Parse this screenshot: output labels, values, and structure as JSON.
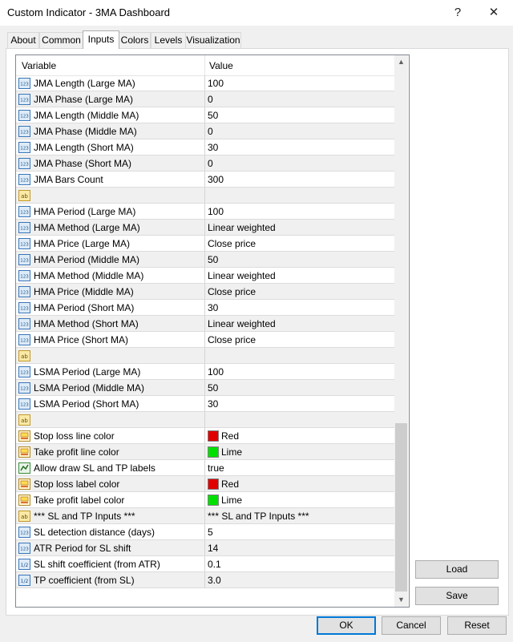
{
  "window": {
    "title": "Custom Indicator - 3MA Dashboard",
    "help": "?",
    "close": "✕"
  },
  "tabs": [
    "About",
    "Common",
    "Inputs",
    "Colors",
    "Levels",
    "Visualization"
  ],
  "grid": {
    "col_variable": "Variable",
    "col_value": "Value",
    "rows": [
      {
        "icon": "int",
        "name": "JMA Length (Large MA)",
        "value": "100"
      },
      {
        "icon": "int",
        "name": "JMA Phase (Large MA)",
        "value": "0"
      },
      {
        "icon": "int",
        "name": "JMA Length (Middle MA)",
        "value": "50"
      },
      {
        "icon": "int",
        "name": "JMA Phase (Middle MA)",
        "value": "0"
      },
      {
        "icon": "int",
        "name": "JMA Length (Short MA)",
        "value": "30"
      },
      {
        "icon": "int",
        "name": "JMA Phase (Short MA)",
        "value": "0"
      },
      {
        "icon": "int",
        "name": "JMA Bars Count",
        "value": "300"
      },
      {
        "icon": "str",
        "name": "",
        "value": ""
      },
      {
        "icon": "int",
        "name": "HMA Period (Large MA)",
        "value": "100"
      },
      {
        "icon": "int",
        "name": "HMA Method (Large MA)",
        "value": "Linear weighted"
      },
      {
        "icon": "int",
        "name": "HMA Price (Large MA)",
        "value": "Close price"
      },
      {
        "icon": "int",
        "name": "HMA Period (Middle MA)",
        "value": "50"
      },
      {
        "icon": "int",
        "name": "HMA Method (Middle MA)",
        "value": "Linear weighted"
      },
      {
        "icon": "int",
        "name": "HMA Price (Middle MA)",
        "value": "Close price"
      },
      {
        "icon": "int",
        "name": "HMA Period (Short MA)",
        "value": "30"
      },
      {
        "icon": "int",
        "name": "HMA Method (Short MA)",
        "value": "Linear weighted"
      },
      {
        "icon": "int",
        "name": "HMA Price (Short MA)",
        "value": "Close price"
      },
      {
        "icon": "str",
        "name": "",
        "value": ""
      },
      {
        "icon": "int",
        "name": "LSMA Period (Large MA)",
        "value": "100"
      },
      {
        "icon": "int",
        "name": "LSMA Period (Middle MA)",
        "value": "50"
      },
      {
        "icon": "int",
        "name": "LSMA Period (Short MA)",
        "value": "30"
      },
      {
        "icon": "str",
        "name": "",
        "value": ""
      },
      {
        "icon": "color",
        "name": "Stop loss line color",
        "value": "Red",
        "swatch": "#e00000"
      },
      {
        "icon": "color",
        "name": "Take profit line color",
        "value": "Lime",
        "swatch": "#00e000"
      },
      {
        "icon": "bool",
        "name": "Allow draw SL and TP labels",
        "value": "true"
      },
      {
        "icon": "color",
        "name": "Stop loss label color",
        "value": "Red",
        "swatch": "#e00000"
      },
      {
        "icon": "color",
        "name": "Take profit label color",
        "value": "Lime",
        "swatch": "#00e000"
      },
      {
        "icon": "str",
        "name": "*** SL and TP Inputs ***",
        "value": "*** SL and TP Inputs ***"
      },
      {
        "icon": "int",
        "name": "SL detection distance (days)",
        "value": "5"
      },
      {
        "icon": "int",
        "name": "ATR Period for SL shift",
        "value": "14"
      },
      {
        "icon": "dbl",
        "name": "SL shift coefficient (from ATR)",
        "value": "0.1"
      },
      {
        "icon": "dbl",
        "name": "TP coefficient (from SL)",
        "value": "3.0"
      }
    ]
  },
  "side_buttons": {
    "load": "Load",
    "save": "Save"
  },
  "bottom_buttons": {
    "ok": "OK",
    "cancel": "Cancel",
    "reset": "Reset"
  },
  "icon_labels": {
    "int": "123",
    "str": "ab",
    "dbl": "1/2"
  }
}
